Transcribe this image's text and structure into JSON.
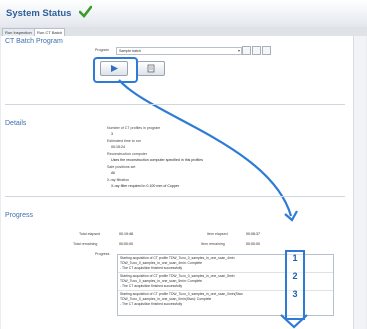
{
  "header": {
    "title": "System Status"
  },
  "tabs": [
    "Run Inspection",
    "Run CT Batch"
  ],
  "panel": {
    "title": "CT Batch Program",
    "program_label": "Program",
    "program_value": "Sample batch"
  },
  "details": {
    "title": "Details",
    "num_profiles_label": "Number of CT profiles in program",
    "num_profiles": "3",
    "est_time_label": "Estimated time to run",
    "est_time": "00:15:24",
    "recon_label": "Reconstruction computer",
    "recon_value": "Uses the reconstruction computer specified in this profiles",
    "safe_label": "Safe positions set",
    "safe_value": "All",
    "xray_label": "X-ray filtration",
    "xray_value": "X-ray filter required in 0.100 mm of Copper"
  },
  "progress": {
    "title": "Progress",
    "total_elapsed_label": "Total elapsed",
    "total_elapsed": "00:19:48",
    "item_elapsed_label": "Item elapsed",
    "item_elapsed": "00:06:37",
    "total_remaining_label": "Total remaining",
    "total_remaining": "00:00:00",
    "item_remaining_label": "Item remaining",
    "item_remaining": "00:00:00",
    "progress_label": "Progress",
    "log": [
      "Starting acquisition of CT profile TDW_Tuxo_0_samples_in_one_scan_4min",
      "TDW_Tuxo_0_samples_in_one_scan_4min: Complete",
      "- The CT acquisition finished successfully",
      "Starting acquisition of CT profile TDW_Tuxo_0_samples_in_one_scan_5min",
      "TDW_Tuxo_0_samples_in_one_scan_5min: Complete",
      "- The CT acquisition finished successfully",
      "Starting acquisition of CT profile TDW_Tuxo_0_samples_in_one_scan_0min(Stan",
      "TDW_Tuxo_0_samples_in_one_scan_0min(Stan): Complete",
      "- The CT acquisition finished successfully"
    ]
  },
  "annotations": {
    "markers": [
      "1",
      "2",
      "3"
    ]
  },
  "icons": [
    "check-icon",
    "play-icon",
    "stop-icon",
    "save-icon",
    "edit-icon",
    "delete-icon"
  ]
}
